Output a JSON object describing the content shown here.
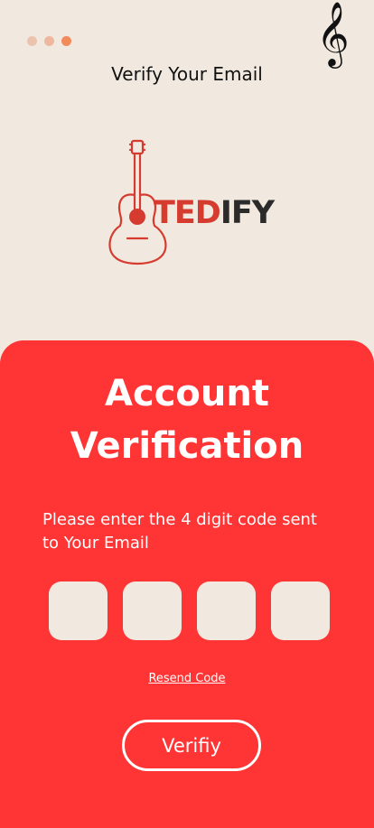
{
  "header": {
    "title": "Verify Your Email",
    "clef_icon": "treble-clef-icon"
  },
  "logo": {
    "icon": "guitar-icon",
    "brand_part1": "TED",
    "brand_part2": "IFY"
  },
  "colors": {
    "background": "#f1e9df",
    "card": "#ff3434",
    "brand_red": "#d63b2f",
    "brand_dark": "#2b2b2b",
    "dot_active": "#f28b5c"
  },
  "verification": {
    "title_line1": "Account",
    "title_line2": "Verification",
    "instruction": "Please enter the 4 digit code sent to Your Email",
    "code_values": [
      "",
      "",
      "",
      ""
    ],
    "resend_label": "Resend Code",
    "verify_label": "Verifiy"
  }
}
